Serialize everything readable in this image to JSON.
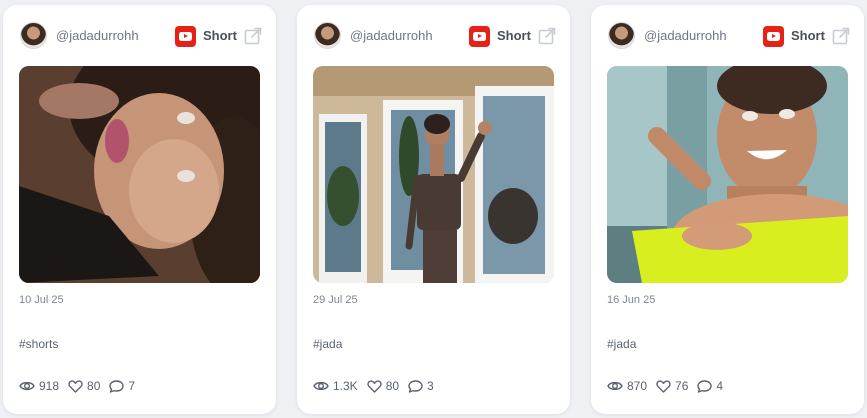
{
  "posts": [
    {
      "handle": "@jadadurrohh",
      "platform_label": "Short",
      "date": "10 Jul 25",
      "caption": "#shorts",
      "views": "918",
      "likes": "80",
      "comments": "7"
    },
    {
      "handle": "@jadadurrohh",
      "platform_label": "Short",
      "date": "29 Jul 25",
      "caption": "#jada",
      "views": "1.3K",
      "likes": "80",
      "comments": "3"
    },
    {
      "handle": "@jadadurrohh",
      "platform_label": "Short",
      "date": "16 Jun 25",
      "caption": "#jada",
      "views": "870",
      "likes": "76",
      "comments": "4"
    }
  ],
  "icons": {
    "platform": "youtube-icon",
    "external": "external-link-icon",
    "views": "eye-icon",
    "likes": "heart-icon",
    "comments": "comment-icon"
  },
  "colors": {
    "background": "#eef0f4",
    "card": "#ffffff",
    "youtube_red": "#e62117",
    "muted_text": "#7d8591"
  }
}
